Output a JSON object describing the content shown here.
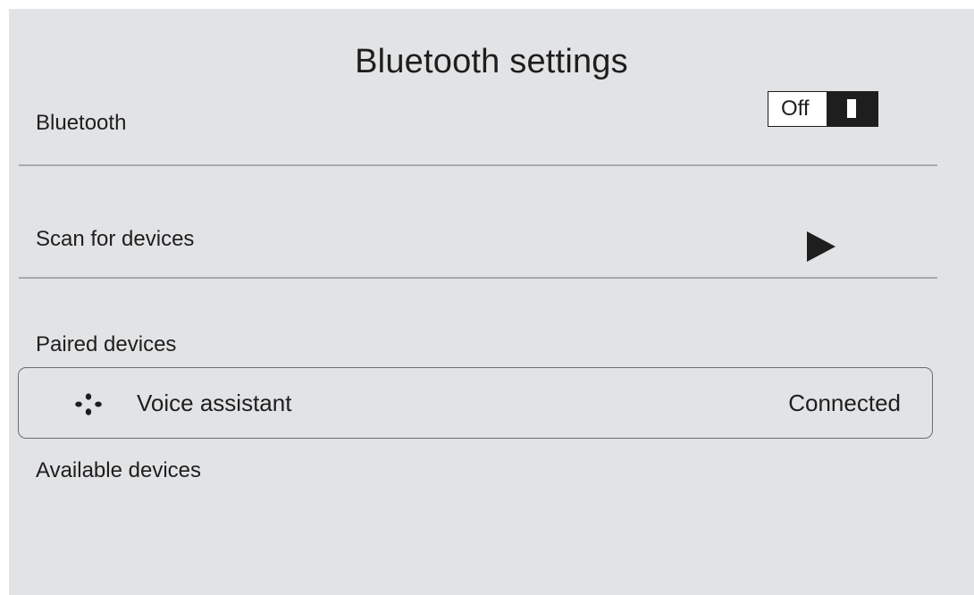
{
  "page": {
    "title": "Bluetooth settings"
  },
  "bluetooth": {
    "label": "Bluetooth",
    "toggle_state": "Off"
  },
  "scan": {
    "label": "Scan for devices",
    "icon": "play-icon"
  },
  "paired": {
    "heading": "Paired devices",
    "devices": [
      {
        "icon": "voice-assistant-icon",
        "name": "Voice assistant",
        "status": "Connected"
      }
    ]
  },
  "available": {
    "heading": "Available devices"
  },
  "colors": {
    "background": "#e2e3e5",
    "text": "#1e1e1e",
    "divider": "#a9aaac",
    "toggle_knob": "#1e1e1e"
  }
}
